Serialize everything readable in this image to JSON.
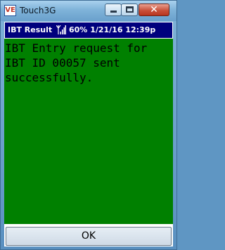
{
  "window": {
    "title": "Touch3G",
    "app_icon_text": "VE",
    "close_glyph": "✕"
  },
  "status_bar": {
    "title": "IBT Result",
    "battery": "60%",
    "date": "1/21/16",
    "time": "12:39p"
  },
  "message": "IBT Entry request for IBT ID 00057 sent successfully.",
  "ok_label": "OK",
  "colors": {
    "status_bar_bg": "#00007d",
    "message_bg": "#008000",
    "close_button": "#c9513b"
  }
}
